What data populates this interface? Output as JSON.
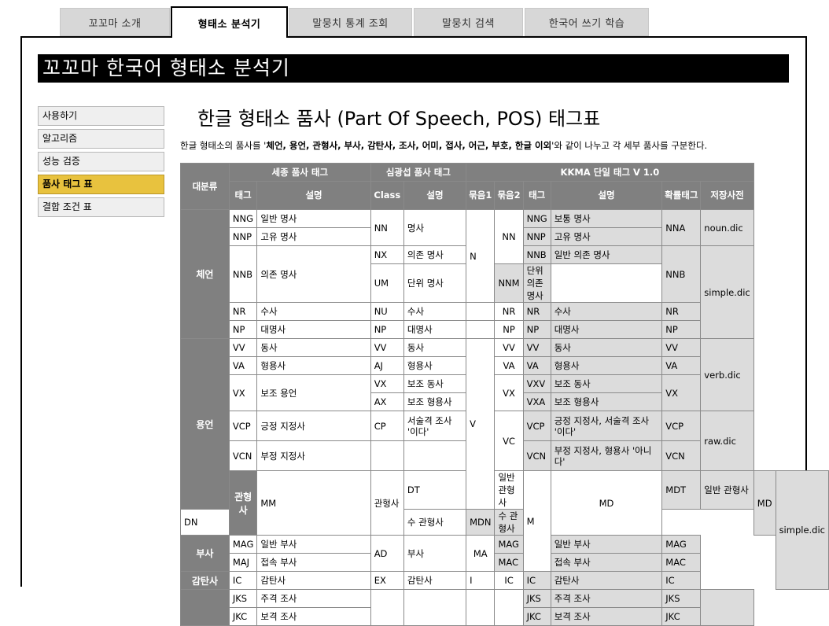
{
  "tabs": [
    {
      "label": "꼬꼬마 소개"
    },
    {
      "label": "형태소 분석기"
    },
    {
      "label": "말뭉치 통계 조회"
    },
    {
      "label": "말뭉치 검색"
    },
    {
      "label": "한국어 쓰기 학습"
    }
  ],
  "banner": "꼬꼬마 한국어 형태소 분석기",
  "sidebar": {
    "items": [
      {
        "label": "사용하기"
      },
      {
        "label": "알고리즘"
      },
      {
        "label": "성능 검증"
      },
      {
        "label": "품사 태그 표"
      },
      {
        "label": "결합 조건 표"
      }
    ]
  },
  "page_title": "한글 형태소 품사 (Part Of Speech, POS) 태그표",
  "intro": {
    "prefix": "한글 형태소의 품사를 '",
    "bold": "체언, 용언, 관형사, 부사, 감탄사, 조사, 어미, 접사, 어근, 부호, 한글 이외",
    "suffix": "'와 같이 나누고 각 세부 품사를 구분한다."
  },
  "table": {
    "headers": {
      "category": "대분류",
      "sejong": "세종 품사 태그",
      "simkwang": "심광섭 품사 태그",
      "kkma": "KKMA 단일 태그 V 1.0",
      "tag": "태그",
      "desc": "설명",
      "class": "Class",
      "group1": "묶음1",
      "group2": "묶음2",
      "prob_tag": "확률태그",
      "dict": "저장사전"
    },
    "cat": {
      "cheeon": "체언",
      "yongeon": "용언",
      "gwanhyeongsa": "관형사",
      "busa": "부사",
      "gamtansa": "감탄사"
    },
    "r1": {
      "sj_tag": "NNG",
      "sj_desc": "일반 명사",
      "sk_class": "NN",
      "sk_desc": "명사",
      "g1": "N",
      "g2": "NN",
      "k_tag": "NNG",
      "k_desc": "보통 명사",
      "prob": "NNA",
      "dict": "noun.dic"
    },
    "r2": {
      "sj_tag": "NNP",
      "sj_desc": "고유 명사",
      "k_tag": "NNP",
      "k_desc": "고유 명사"
    },
    "r3": {
      "sj_tag": "NNB",
      "sj_desc": "의존 명사",
      "sk_class": "NX",
      "sk_desc": "의존 명사",
      "k_tag": "NNB",
      "k_desc": "일반 의존 명사",
      "prob": "NNB",
      "dict": "simple.dic"
    },
    "r4": {
      "sk_class": "UM",
      "sk_desc": "단위 명사",
      "k_tag": "NNM",
      "k_desc": "단위 의존 명사"
    },
    "r5": {
      "sj_tag": "NR",
      "sj_desc": "수사",
      "sk_class": "NU",
      "sk_desc": "수사",
      "g2": "NR",
      "k_tag": "NR",
      "k_desc": "수사",
      "prob": "NR"
    },
    "r6": {
      "sj_tag": "NP",
      "sj_desc": "대명사",
      "sk_class": "NP",
      "sk_desc": "대명사",
      "g2": "NP",
      "k_tag": "NP",
      "k_desc": "대명사",
      "prob": "NP"
    },
    "r7": {
      "sj_tag": "VV",
      "sj_desc": "동사",
      "sk_class": "VV",
      "sk_desc": "동사",
      "g1": "V",
      "g2": "VV",
      "k_tag": "VV",
      "k_desc": "동사",
      "prob": "VV",
      "dict": "verb.dic"
    },
    "r8": {
      "sj_tag": "VA",
      "sj_desc": "형용사",
      "sk_class": "AJ",
      "sk_desc": "형용사",
      "g2": "VA",
      "k_tag": "VA",
      "k_desc": "형용사",
      "prob": "VA"
    },
    "r9": {
      "sj_tag": "VX",
      "sj_desc": "보조 용언",
      "sk_class": "VX",
      "sk_desc": "보조 동사",
      "g2": "VX",
      "k_tag": "VXV",
      "k_desc": "보조 동사",
      "prob": "VX"
    },
    "r10": {
      "sk_class": "AX",
      "sk_desc": "보조 형용사",
      "k_tag": "VXA",
      "k_desc": "보조 형용사"
    },
    "r11": {
      "sj_tag": "VCP",
      "sj_desc": "긍정 지정사",
      "sk_class": "CP",
      "sk_desc": "서술격 조사 '이다'",
      "g2": "VC",
      "k_tag": "VCP",
      "k_desc": "긍정 지정사, 서술격 조사 '이다'",
      "prob": "VCP",
      "dict": "raw.dic"
    },
    "r12": {
      "sj_tag": "VCN",
      "sj_desc": "부정 지정사",
      "k_tag": "VCN",
      "k_desc": "부정 지정사, 형용사 '아니다'",
      "prob": "VCN"
    },
    "r13": {
      "sj_tag": "MM",
      "sj_desc": "관형사",
      "sk_class": "DT",
      "sk_desc": "일반 관형사",
      "g1": "M",
      "g2": "MD",
      "k_tag": "MDT",
      "k_desc": "일반 관형사",
      "prob": "MD",
      "dict": "simple.dic"
    },
    "r14": {
      "sk_class": "DN",
      "sk_desc": "수 관형사",
      "k_tag": "MDN",
      "k_desc": "수 관형사"
    },
    "r15": {
      "sj_tag": "MAG",
      "sj_desc": "일반 부사",
      "sk_class": "AD",
      "sk_desc": "부사",
      "g2": "MA",
      "k_tag": "MAG",
      "k_desc": "일반 부사",
      "prob": "MAG"
    },
    "r16": {
      "sj_tag": "MAJ",
      "sj_desc": "접속 부사",
      "k_tag": "MAC",
      "k_desc": "접속 부사",
      "prob": "MAC"
    },
    "r17": {
      "sj_tag": "IC",
      "sj_desc": "감탄사",
      "sk_class": "EX",
      "sk_desc": "감탄사",
      "g1": "I",
      "g2": "IC",
      "k_tag": "IC",
      "k_desc": "감탄사",
      "prob": "IC"
    },
    "r18": {
      "sj_tag": "JKS",
      "sj_desc": "주격 조사",
      "k_tag": "JKS",
      "k_desc": "주격 조사",
      "prob": "JKS"
    },
    "r19": {
      "sj_tag": "JKC",
      "sj_desc": "보격 조사",
      "k_tag": "JKC",
      "k_desc": "보격 조사",
      "prob": "JKC"
    }
  }
}
